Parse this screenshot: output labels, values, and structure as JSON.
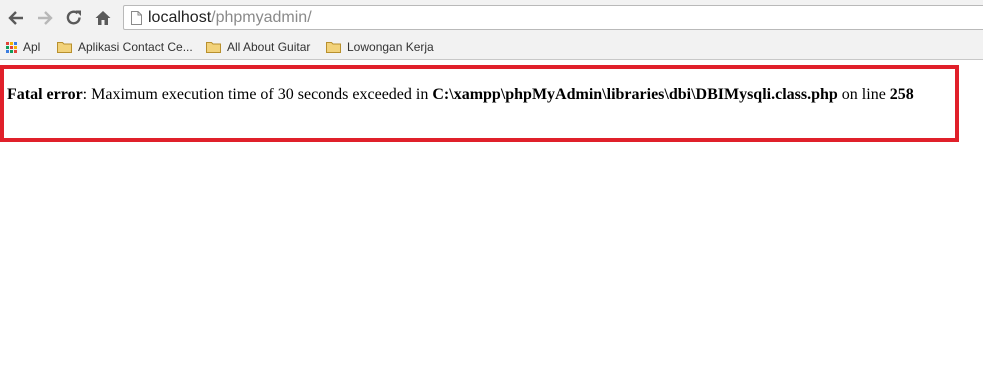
{
  "browser": {
    "nav": {
      "back_icon": "arrow-left-icon",
      "forward_icon": "arrow-right-icon",
      "reload_icon": "reload-icon",
      "home_icon": "home-icon"
    },
    "address": {
      "host": "localhost",
      "path": "/phpmyadmin/"
    },
    "bookmarks": [
      {
        "label": "Apl",
        "icon": "apps-grid-icon"
      },
      {
        "label": "Aplikasi Contact Ce...",
        "icon": "folder-icon"
      },
      {
        "label": "All About Guitar",
        "icon": "folder-icon"
      },
      {
        "label": "Lowongan Kerja",
        "icon": "folder-icon"
      }
    ]
  },
  "error": {
    "label": "Fatal error",
    "message_part1": ": Maximum execution time of 30 seconds exceeded in ",
    "file": "C:\\xampp\\phpMyAdmin\\libraries\\dbi\\DBIMysqli.class.php",
    "message_part2": " on line ",
    "line": "258"
  },
  "colors": {
    "highlight_border": "#e0202a",
    "folder": "#e8c055",
    "chrome_bg": "#f2f2f2"
  }
}
